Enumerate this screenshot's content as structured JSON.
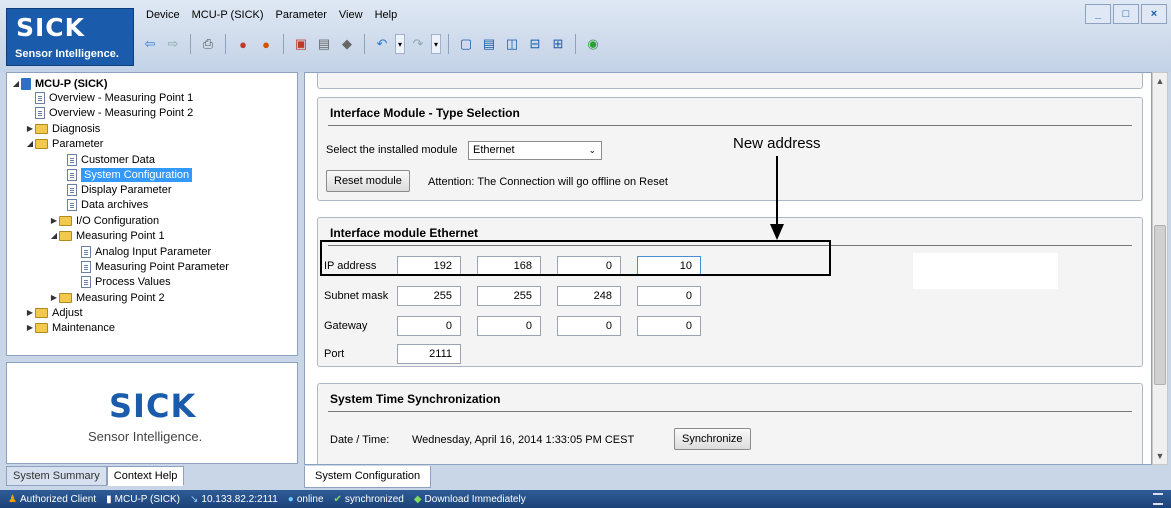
{
  "app": {
    "brand": "SICK",
    "tagline": "Sensor Intelligence.",
    "menu": [
      "Device",
      "MCU-P (SICK)",
      "Parameter",
      "View",
      "Help"
    ],
    "window_buttons": [
      "_",
      "□",
      "×"
    ]
  },
  "toolbar_icons": [
    "back-icon",
    "forward-icon",
    "print-icon",
    "user-login-icon",
    "users-icon",
    "export-icon",
    "import-icon",
    "eraser-icon",
    "undo-icon",
    "redo-icon",
    "layout-1-icon",
    "layout-2-icon",
    "layout-3-icon",
    "layout-4-icon",
    "layout-5-icon",
    "help-icon"
  ],
  "tree": {
    "root": "MCU-P (SICK)",
    "items": [
      {
        "label": "Overview - Measuring Point 1",
        "type": "doc"
      },
      {
        "label": "Overview - Measuring Point 2",
        "type": "doc"
      },
      {
        "label": "Diagnosis",
        "type": "folder"
      },
      {
        "label": "Parameter",
        "type": "folder"
      },
      {
        "label": "Customer Data",
        "type": "doc"
      },
      {
        "label": "System Configuration",
        "type": "doc",
        "selected": true
      },
      {
        "label": "Display Parameter",
        "type": "doc"
      },
      {
        "label": "Data archives",
        "type": "doc"
      },
      {
        "label": "I/O Configuration",
        "type": "folder"
      },
      {
        "label": "Measuring Point 1",
        "type": "folder"
      },
      {
        "label": "Analog Input Parameter",
        "type": "doc"
      },
      {
        "label": "Measuring Point Parameter",
        "type": "doc"
      },
      {
        "label": "Process Values",
        "type": "doc"
      },
      {
        "label": "Measuring Point 2",
        "type": "folder"
      },
      {
        "label": "Adjust",
        "type": "folder"
      },
      {
        "label": "Maintenance",
        "type": "folder"
      }
    ]
  },
  "help_panel": {
    "brand": "SICK",
    "tagline": "Sensor Intelligence."
  },
  "left_tabs": [
    "System Summary",
    "Context Help"
  ],
  "interface_type": {
    "title": "Interface Module - Type Selection",
    "select_label": "Select the installed module",
    "selected_module": "Ethernet",
    "reset_button": "Reset module",
    "attention": "Attention: The Connection will go offline on Reset"
  },
  "ethernet": {
    "title": "Interface module Ethernet",
    "ip_label": "IP address",
    "ip": [
      "192",
      "168",
      "0",
      "10"
    ],
    "subnet_label": "Subnet mask",
    "subnet": [
      "255",
      "255",
      "248",
      "0"
    ],
    "gateway_label": "Gateway",
    "gateway": [
      "0",
      "0",
      "0",
      "0"
    ],
    "port_label": "Port",
    "port": "2111"
  },
  "annotation": "New address",
  "time_sync": {
    "title": "System Time Synchronization",
    "label": "Date / Time:",
    "value": "Wednesday, April 16, 2014 1:33:05 PM CEST",
    "button": "Synchronize"
  },
  "content_tab": "System Configuration",
  "status": {
    "client": "Authorized Client",
    "device": "MCU-P (SICK)",
    "address": "10.133.82.2:2111",
    "online": "online",
    "sync": "synchronized",
    "download": "Download Immediately"
  }
}
